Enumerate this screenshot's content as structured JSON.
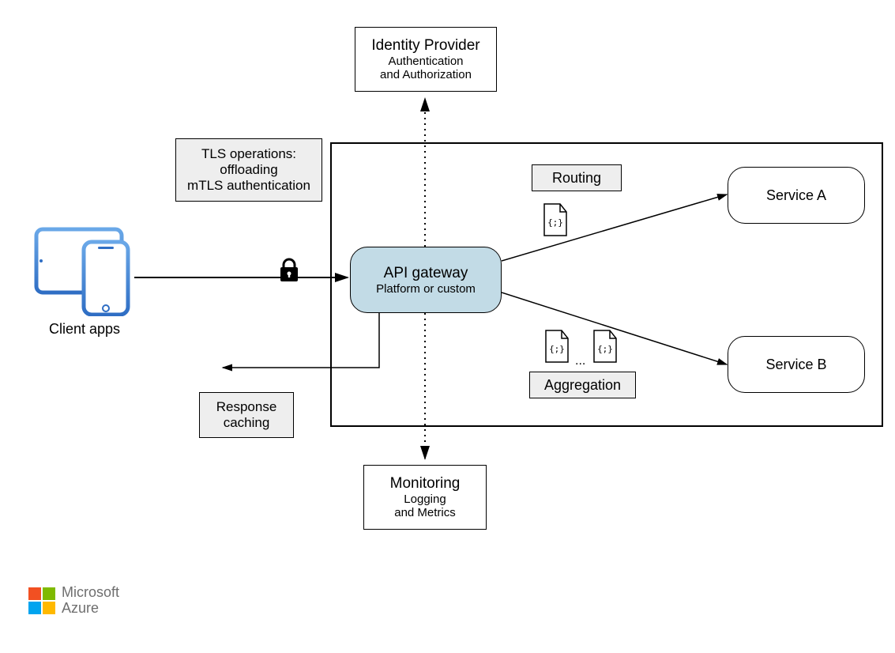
{
  "identity": {
    "title": "Identity Provider",
    "line1": "Authentication",
    "line2": "and Authorization"
  },
  "tls": {
    "line1": "TLS operations:",
    "line2": "offloading",
    "line3": "mTLS authentication"
  },
  "routing": {
    "label": "Routing"
  },
  "aggregation": {
    "label": "Aggregation"
  },
  "gateway": {
    "title": "API gateway",
    "sub": "Platform or custom"
  },
  "serviceA": {
    "label": "Service A"
  },
  "serviceB": {
    "label": "Service B"
  },
  "client": {
    "label": "Client apps"
  },
  "response": {
    "line1": "Response",
    "line2": "caching"
  },
  "monitoring": {
    "title": "Monitoring",
    "line1": "Logging",
    "line2": "and Metrics"
  },
  "ellipsis": "...",
  "logo": {
    "brand": "Microsoft",
    "product": "Azure"
  },
  "colors": {
    "gatewayFill": "#c2dbe6",
    "deviceBlue1": "#4e8dd9",
    "deviceBlue2": "#2f6ec4"
  }
}
